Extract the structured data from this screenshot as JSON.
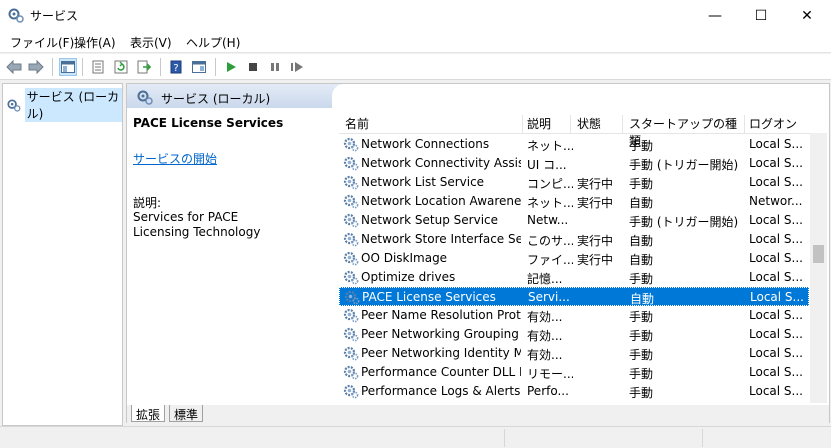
{
  "window": {
    "title": "サービス",
    "minimize": "—",
    "maximize": "☐",
    "close": "✕"
  },
  "menu": [
    "ファイル(F)",
    "操作(A)",
    "表示(V)",
    "ヘルプ(H)"
  ],
  "tree": {
    "root_label": "サービス (ローカル)"
  },
  "pane": {
    "header": "サービス (ローカル)"
  },
  "detail": {
    "service_name": "PACE License Services",
    "start_link": "サービスの開始",
    "description_label": "説明:",
    "description": "Services for PACE Licensing Technology"
  },
  "columns": {
    "name": "名前",
    "description": "説明",
    "status": "状態",
    "startup": "スタートアップの種類",
    "logon": "ログオン"
  },
  "services": [
    {
      "name": "Network Connections",
      "desc": "ネット...",
      "status": "",
      "startup": "手動",
      "logon": "Local S..."
    },
    {
      "name": "Network Connectivity Assist...",
      "desc": "UI コ...",
      "status": "",
      "startup": "手動 (トリガー開始)",
      "logon": "Local S..."
    },
    {
      "name": "Network List Service",
      "desc": "コンピ...",
      "status": "実行中",
      "startup": "手動",
      "logon": "Local S..."
    },
    {
      "name": "Network Location Awareness",
      "desc": "ネット...",
      "status": "実行中",
      "startup": "自動",
      "logon": "Networ..."
    },
    {
      "name": "Network Setup Service",
      "desc": "Netw...",
      "status": "",
      "startup": "手動 (トリガー開始)",
      "logon": "Local S..."
    },
    {
      "name": "Network Store Interface Ser...",
      "desc": "このサ...",
      "status": "実行中",
      "startup": "自動",
      "logon": "Local S..."
    },
    {
      "name": "OO DiskImage",
      "desc": "ファイ...",
      "status": "実行中",
      "startup": "自動",
      "logon": "Local S..."
    },
    {
      "name": "Optimize drives",
      "desc": "記憶...",
      "status": "",
      "startup": "手動",
      "logon": "Local S..."
    },
    {
      "name": "PACE License Services",
      "desc": "Servi...",
      "status": "",
      "startup": "自動",
      "logon": "Local S...",
      "selected": true
    },
    {
      "name": "Peer Name Resolution Prot...",
      "desc": "有効...",
      "status": "",
      "startup": "手動",
      "logon": "Local S..."
    },
    {
      "name": "Peer Networking Grouping",
      "desc": "有効...",
      "status": "",
      "startup": "手動",
      "logon": "Local S..."
    },
    {
      "name": "Peer Networking Identity M...",
      "desc": "有効...",
      "status": "",
      "startup": "手動",
      "logon": "Local S..."
    },
    {
      "name": "Performance Counter DLL H...",
      "desc": "リモー...",
      "status": "",
      "startup": "手動",
      "logon": "Local S..."
    },
    {
      "name": "Performance Logs & Alerts",
      "desc": "Perfo...",
      "status": "",
      "startup": "手動",
      "logon": "Local S..."
    }
  ],
  "tabs": [
    "拡張",
    "標準"
  ],
  "colors": {
    "selection": "#0078d7",
    "link": "#0066cc",
    "header_grad": "#cad8ec"
  }
}
